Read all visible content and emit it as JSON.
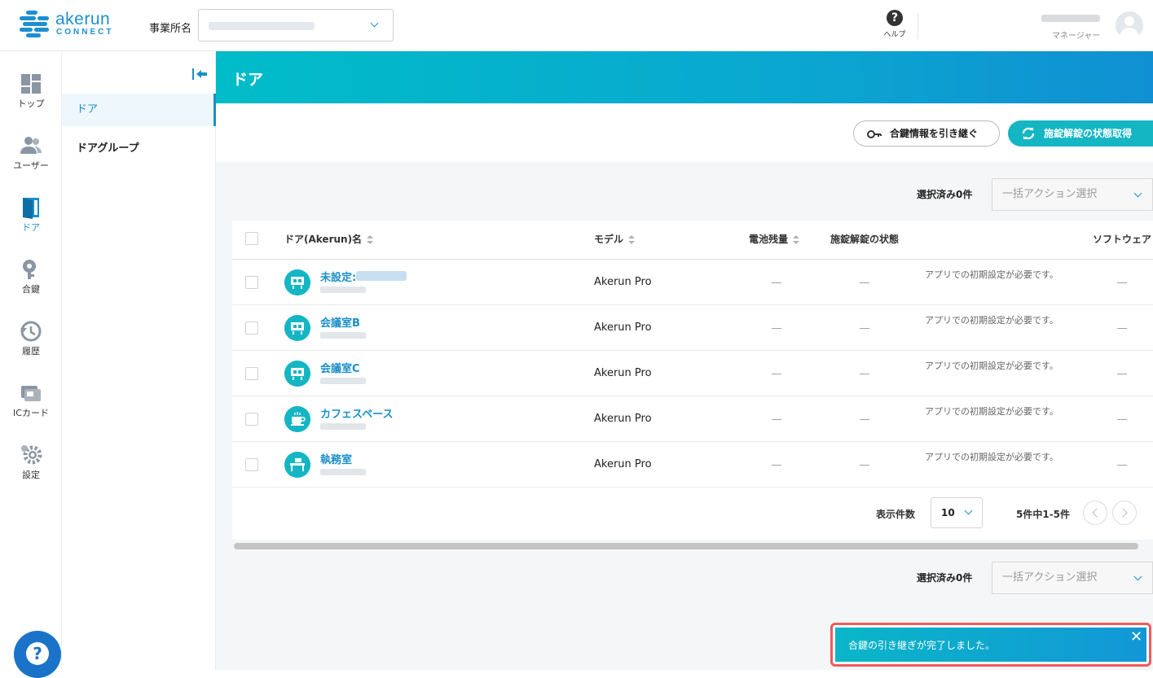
{
  "header": {
    "logo_word": "akerun",
    "logo_sub": "CONNECT",
    "office_label": "事業所名",
    "help_label": "ヘルプ",
    "user_role": "マネージャー"
  },
  "sidebar": {
    "items": [
      {
        "label": "トップ"
      },
      {
        "label": "ユーザー"
      },
      {
        "label": "ドア"
      },
      {
        "label": "合鍵"
      },
      {
        "label": "履歴"
      },
      {
        "label": "ICカード"
      },
      {
        "label": "設定"
      }
    ],
    "help_fab": "?"
  },
  "subnav": {
    "items": [
      {
        "label": "ドア"
      },
      {
        "label": "ドアグループ"
      }
    ]
  },
  "page": {
    "title": "ドア",
    "inherit_button": "合鍵情報を引き継ぐ",
    "lock_status_button": "施錠解錠の状態取得",
    "selected_count": "選択済み0件",
    "bulk_action_placeholder": "一括アクション選択"
  },
  "table": {
    "columns": [
      "ドア(Akerun)名",
      "モデル",
      "電池残量",
      "施錠解錠の状態",
      "ソフトウェア"
    ],
    "rows": [
      {
        "name": "未設定:",
        "model": "Akerun Pro",
        "battery": "—",
        "lock_state": "—",
        "note": "アプリでの初期設定が必要です。",
        "software": "—"
      },
      {
        "name": "会議室B",
        "model": "Akerun Pro",
        "battery": "—",
        "lock_state": "—",
        "note": "アプリでの初期設定が必要です。",
        "software": "—"
      },
      {
        "name": "会議室C",
        "model": "Akerun Pro",
        "battery": "—",
        "lock_state": "—",
        "note": "アプリでの初期設定が必要です。",
        "software": "—"
      },
      {
        "name": "カフェスペース",
        "model": "Akerun Pro",
        "battery": "—",
        "lock_state": "—",
        "note": "アプリでの初期設定が必要です。",
        "software": "—"
      },
      {
        "name": "執務室",
        "model": "Akerun Pro",
        "battery": "—",
        "lock_state": "—",
        "note": "アプリでの初期設定が必要です。",
        "software": "—"
      }
    ]
  },
  "pagination": {
    "per_page_label": "表示件数",
    "per_page_value": "10",
    "range": "5件中1-5件"
  },
  "toast": {
    "message": "合鍵の引き継ぎが完了しました。"
  },
  "colors": {
    "accent": "#1a8fc8",
    "teal": "#14b6c4",
    "toast_border": "#ef5b5b"
  }
}
